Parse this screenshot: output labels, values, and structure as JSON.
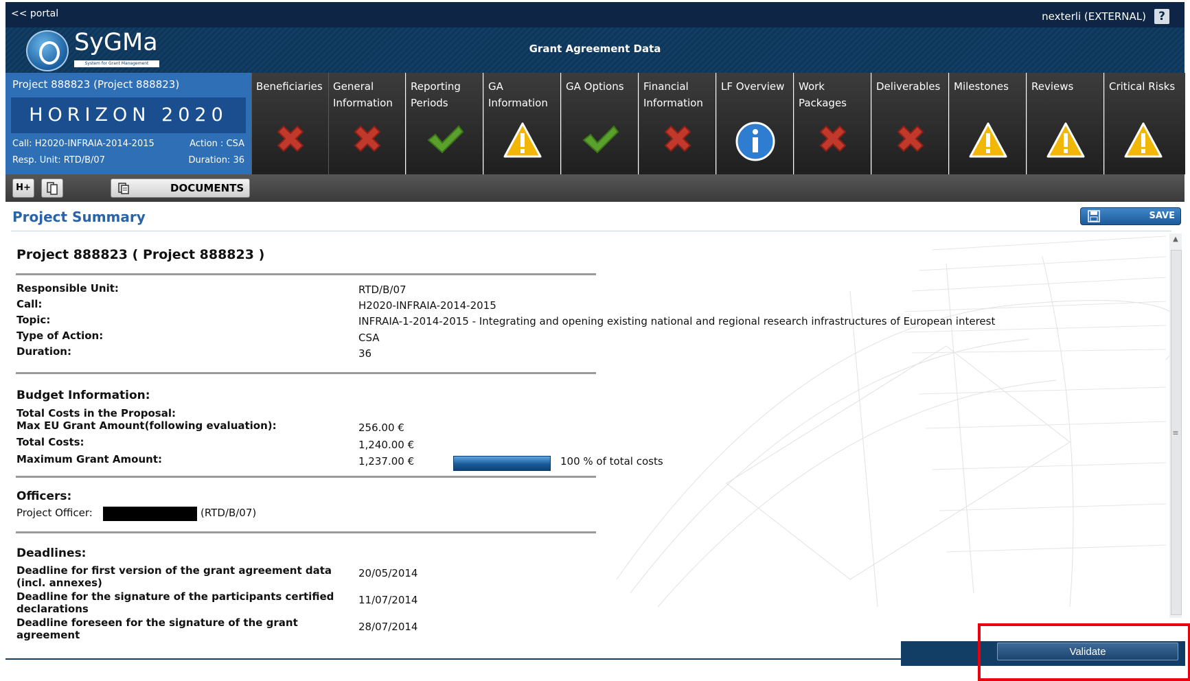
{
  "topbar": {
    "portal_link": "<< portal",
    "user": "nexterli (EXTERNAL)",
    "help": "?"
  },
  "header": {
    "logo_text": "SyGMa",
    "logo_sub": "System for Grant Management",
    "title": "Grant Agreement Data"
  },
  "project_card": {
    "title": "Project 888823 (Project 888823)",
    "program": "HORIZON 2020",
    "call": "Call: H2020-INFRAIA-2014-2015",
    "action": "Action : CSA",
    "resp_unit": "Resp. Unit: RTD/B/07",
    "duration": "Duration: 36"
  },
  "tabs": [
    {
      "label": "Beneficiaries",
      "status": "error"
    },
    {
      "label": "General Information",
      "status": "error"
    },
    {
      "label": "Reporting Periods",
      "status": "ok"
    },
    {
      "label": "GA Information",
      "status": "warning"
    },
    {
      "label": "GA Options",
      "status": "ok"
    },
    {
      "label": "Financial Information",
      "status": "error"
    },
    {
      "label": "LF Overview",
      "status": "info"
    },
    {
      "label": "Work Packages",
      "status": "error"
    },
    {
      "label": "Deliverables",
      "status": "error"
    },
    {
      "label": "Milestones",
      "status": "warning"
    },
    {
      "label": "Reviews",
      "status": "warning"
    },
    {
      "label": "Critical Risks",
      "status": "warning"
    }
  ],
  "toolbar": {
    "documents": "DOCUMENTS"
  },
  "summary": {
    "title": "Project Summary",
    "save": "SAVE",
    "project_heading": "Project 888823 ( Project 888823 )",
    "details": [
      {
        "label": "Responsible Unit:",
        "value": "RTD/B/07"
      },
      {
        "label": "Call:",
        "value": "H2020-INFRAIA-2014-2015"
      },
      {
        "label": "Topic:",
        "value": "INFRAIA-1-2014-2015 - Integrating and opening existing national and regional research infrastructures of European interest"
      },
      {
        "label": "Type of Action:",
        "value": "CSA"
      },
      {
        "label": "Duration:",
        "value": "36"
      }
    ],
    "budget": {
      "heading": "Budget Information:",
      "total_costs_proposal": "Total Costs in the Proposal:",
      "max_eu_label": "Max EU Grant Amount(following evaluation):",
      "max_eu_value": "256.00 €",
      "total_costs_label": "Total Costs:",
      "total_costs_value": "1,240.00 €",
      "max_grant_label": "Maximum Grant Amount:",
      "max_grant_value": "1,237.00 €",
      "grant_percent": 100,
      "grant_percent_text": "100 % of total costs"
    },
    "officers": {
      "heading": "Officers:",
      "po_label": "Project Officer:",
      "po_unit": "(RTD/B/07)"
    },
    "deadlines": {
      "heading": "Deadlines:",
      "items": [
        {
          "label": "Deadline for first version of the grant agreement data (incl. annexes)",
          "value": "20/05/2014"
        },
        {
          "label": "Deadline for the signature of the participants certified declarations",
          "value": "11/07/2014"
        },
        {
          "label": "Deadline foreseen for the signature of the grant agreement",
          "value": "28/07/2014"
        }
      ]
    }
  },
  "footer": {
    "validate": "Validate"
  },
  "colors": {
    "navy": "#0e2545",
    "blue": "#2f6fb5",
    "title_blue": "#2a63a8",
    "error_red": "#c0392b",
    "ok_green": "#5aa02c",
    "warn_yellow": "#f2b705",
    "highlight": "#e8000c"
  }
}
